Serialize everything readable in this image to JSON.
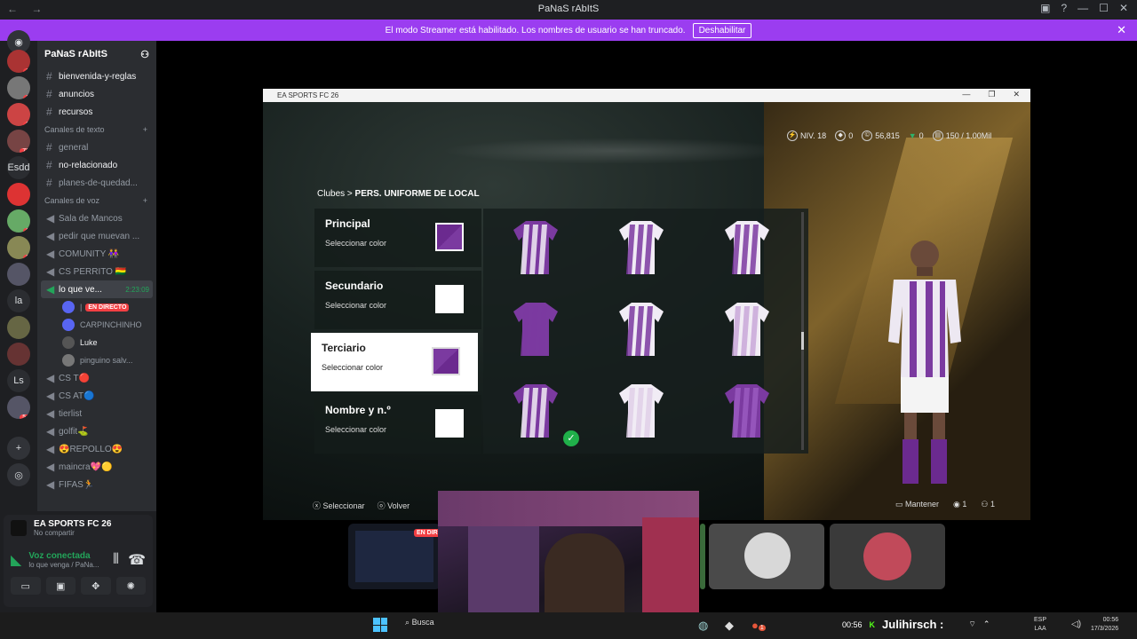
{
  "window": {
    "title": "PaNaS rAbItS",
    "nav": "← →"
  },
  "banner": {
    "text": "El modo Streamer está habilitado. Los nombres de usuario se han truncado.",
    "button": "Deshabilitar"
  },
  "servers": [
    {
      "label": "",
      "badge": "1"
    },
    {
      "label": "",
      "badge": "1"
    },
    {
      "label": "",
      "badge": "6"
    },
    {
      "label": "",
      "badge": "78"
    },
    {
      "label": "Esdd",
      "badge": ""
    },
    {
      "label": "",
      "badge": ""
    },
    {
      "label": "",
      "badge": "6"
    },
    {
      "label": "",
      "badge": "6"
    },
    {
      "label": "",
      "badge": ""
    },
    {
      "label": "la",
      "badge": ""
    },
    {
      "label": "",
      "badge": ""
    },
    {
      "label": "",
      "badge": ""
    },
    {
      "label": "Ls",
      "badge": ""
    },
    {
      "label": "",
      "badge": "54"
    }
  ],
  "guild": {
    "name": "PaNaS rAbItS"
  },
  "channels": {
    "top": [
      "bienvenida-y-reglas",
      "anuncios",
      "recursos"
    ],
    "text_category": "Canales de texto",
    "text": [
      "general",
      "no-relacionado",
      "planes-de-quedad..."
    ],
    "voice_category": "Canales de voz",
    "voice": [
      "Sala de Mancos",
      "pedir que muevan ...",
      "COMUNITY 👭",
      "CS PERRITO 🇧🇴"
    ],
    "active": {
      "name": "lo que ve...",
      "timer": "2:23:09"
    },
    "users": [
      {
        "name": "|",
        "live": "EN DIRECTO"
      },
      {
        "name": "CARPINCHINHO",
        "live": ""
      },
      {
        "name": "Luke",
        "live": ""
      },
      {
        "name": "pinguino salv...",
        "live": ""
      }
    ],
    "voice2": [
      "CS T🔴",
      "CS AT🔵",
      "tierlist",
      "golfit⛳",
      "😍REPOLLO😍",
      "maincra💖🟡",
      "FIFAS🏃"
    ]
  },
  "bottom": {
    "game": "EA SPORTS FC 26",
    "game_sub": "No compartir",
    "voice": "Voz conectada",
    "voice_sub": "lo que venga / PaNa..."
  },
  "game": {
    "title": "EA SPORTS FC 26",
    "hud": {
      "level": "NIV. 18",
      "a": "0",
      "coins": "56,815",
      "b": "0",
      "club": "150 / 1.00Mil"
    },
    "breadcrumb_root": "Clubes",
    "breadcrumb_page": "PERS. UNIFORME DE LOCAL",
    "options": [
      {
        "title": "Principal",
        "sub": "Seleccionar color",
        "color": "#6b2a8f"
      },
      {
        "title": "Secundario",
        "sub": "Seleccionar color",
        "color": "#ffffff"
      },
      {
        "title": "Terciario",
        "sub": "Seleccionar color",
        "color": "#6b2a8f"
      },
      {
        "title": "Nombre y n.º",
        "sub": "Seleccionar color",
        "color": "#ffffff"
      }
    ],
    "footer": {
      "select": "Seleccionar",
      "back": "Volver",
      "hold": "Mantener",
      "n1": "1",
      "n2": "1"
    }
  },
  "thumbs": {
    "live": "EN DIR"
  },
  "taskbar": {
    "search": "Busca",
    "time_small": "00:56",
    "name": "Julihirsch :",
    "lang1": "ESP",
    "lang2": "LAA",
    "clock": "00:56",
    "date": "17/3/2026",
    "badge": "1"
  }
}
